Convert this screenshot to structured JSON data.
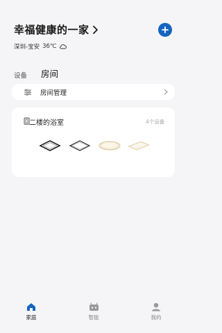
{
  "header": {
    "home_name": "幸福健康的一家",
    "location": "深圳-宝安",
    "temperature": "36℃",
    "weather_icon": "cloud-icon"
  },
  "tabs": [
    {
      "label": "设备",
      "active": false
    },
    {
      "label": "房间",
      "active": true
    }
  ],
  "room_management": {
    "label": "房间管理"
  },
  "rooms": [
    {
      "name": "二楼的浴室",
      "device_count": "4个设备"
    }
  ],
  "bottom_nav": [
    {
      "label": "家庭",
      "icon": "home-icon",
      "active": true
    },
    {
      "label": "智能",
      "icon": "robot-icon",
      "active": false
    },
    {
      "label": "我的",
      "icon": "user-icon",
      "active": false
    }
  ],
  "colors": {
    "accent": "#1565c0",
    "background": "#f5f5f7"
  }
}
